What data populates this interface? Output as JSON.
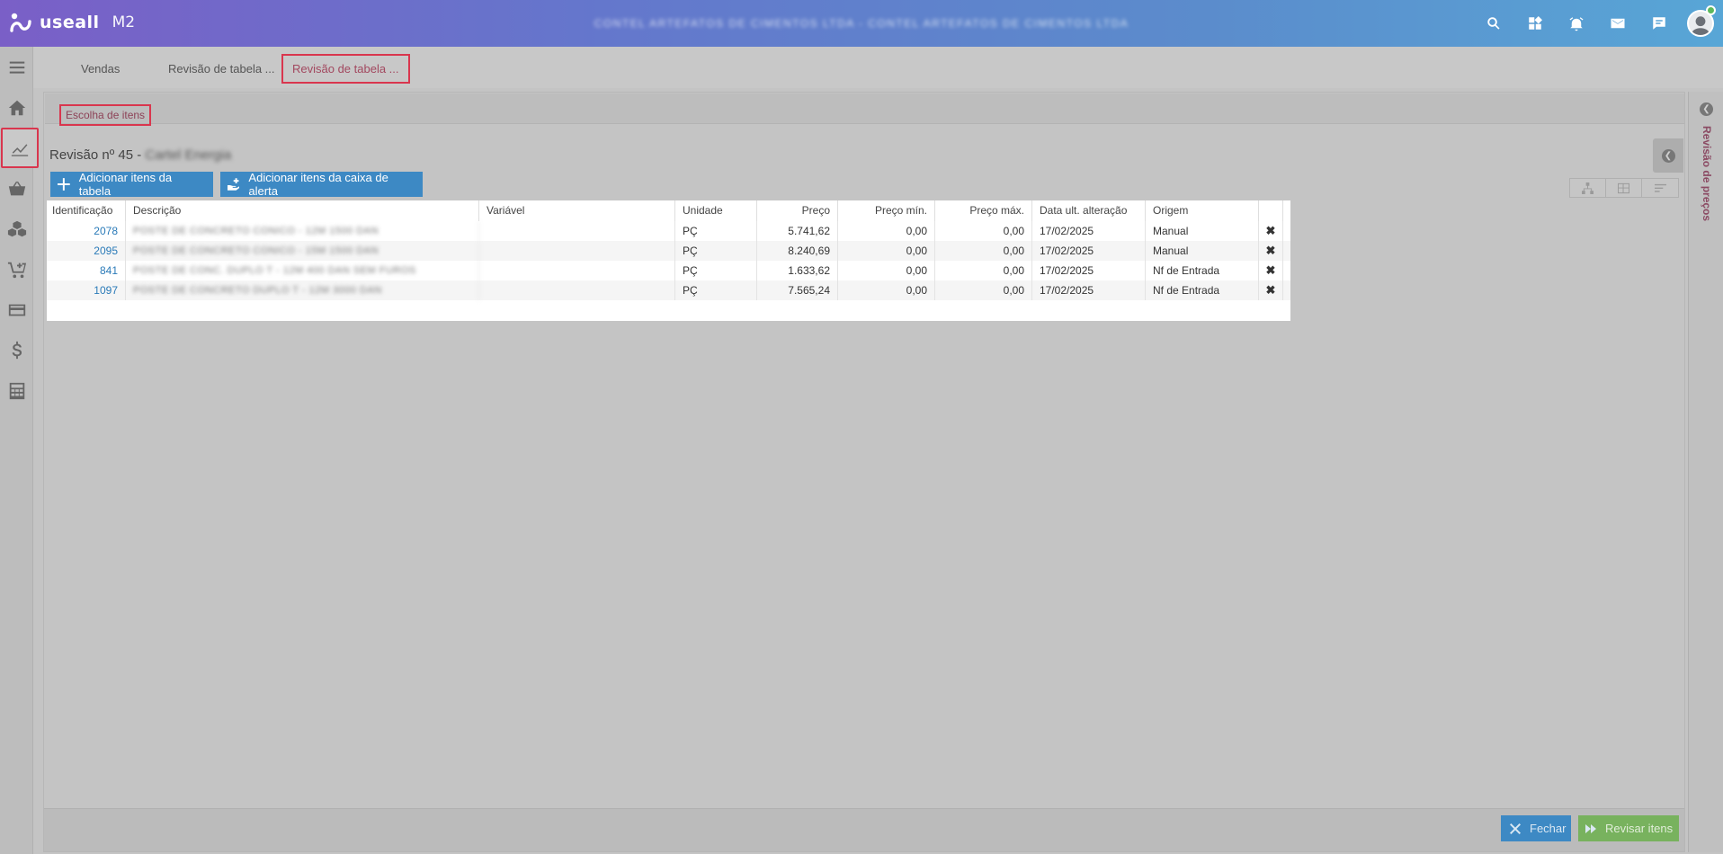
{
  "header": {
    "brand": "useall",
    "product": "M2",
    "company": "CONTEL ARTEFATOS DE CIMENTOS LTDA - CONTEL ARTEFATOS DE CIMENTOS LTDA"
  },
  "tabs": [
    {
      "label": "Vendas"
    },
    {
      "label": "Revisão de tabela ..."
    },
    {
      "label": "Revisão de tabela ..."
    }
  ],
  "subtab": {
    "label": "Escolha de itens"
  },
  "revision": {
    "prefix": "Revisão nº 45 -",
    "name": "Cartel Energia"
  },
  "buttons": {
    "add_table": "Adicionar itens da tabela",
    "add_alert": "Adicionar itens da caixa de alerta",
    "close": "Fechar",
    "review": "Revisar itens"
  },
  "right_panel": {
    "label": "Revisão de preços"
  },
  "table": {
    "columns": [
      "Identificação",
      "Descrição",
      "Variável",
      "Unidade",
      "Preço",
      "Preço mín.",
      "Preço máx.",
      "Data ult. alteração",
      "Origem"
    ],
    "rows": [
      {
        "id": "2078",
        "desc": "POSTE DE CONCRETO CONICO - 12M 1500 DAN",
        "var": "",
        "unit": "PÇ",
        "price": "5.741,62",
        "min": "0,00",
        "max": "0,00",
        "date": "17/02/2025",
        "origin": "Manual"
      },
      {
        "id": "2095",
        "desc": "POSTE DE CONCRETO CONICO - 15M 1500 DAN",
        "var": "",
        "unit": "PÇ",
        "price": "8.240,69",
        "min": "0,00",
        "max": "0,00",
        "date": "17/02/2025",
        "origin": "Manual"
      },
      {
        "id": "841",
        "desc": "POSTE DE CONC. DUPLO T - 12M 400 DAN SEM FUROS",
        "var": "",
        "unit": "PÇ",
        "price": "1.633,62",
        "min": "0,00",
        "max": "0,00",
        "date": "17/02/2025",
        "origin": "Nf de Entrada"
      },
      {
        "id": "1097",
        "desc": "POSTE DE CONCRETO DUPLO T - 12M 3000 DAN",
        "var": "",
        "unit": "PÇ",
        "price": "7.565,24",
        "min": "0,00",
        "max": "0,00",
        "date": "17/02/2025",
        "origin": "Nf de Entrada"
      }
    ],
    "delete_glyph": "✖"
  }
}
